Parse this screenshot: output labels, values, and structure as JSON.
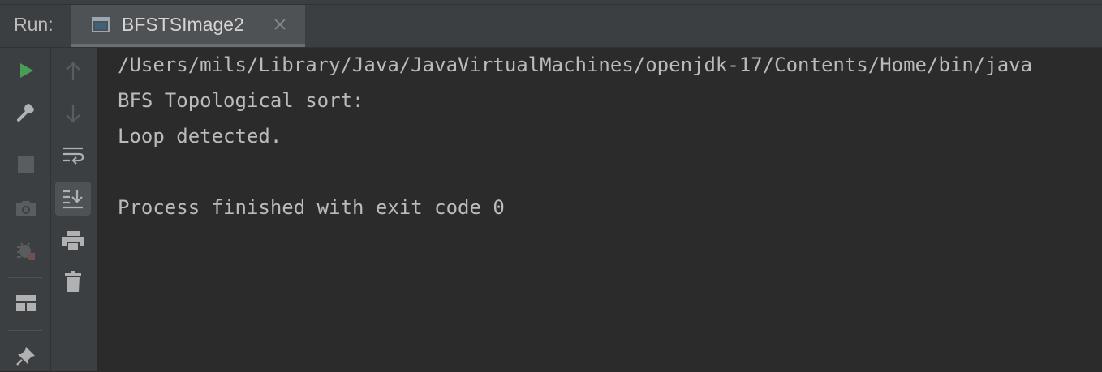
{
  "tool_window": {
    "label": "Run:",
    "tab": {
      "title": "BFSTSImage2",
      "icon": "console-window-icon",
      "close_icon": "close-icon"
    }
  },
  "left_toolbar": {
    "buttons": [
      {
        "name": "rerun-button",
        "icon": "play-icon",
        "color": "#499c54"
      },
      {
        "name": "edit-configuration-button",
        "icon": "wrench-icon"
      },
      {
        "name": "stop-button",
        "icon": "stop-icon",
        "disabled": true
      },
      {
        "name": "dump-threads-button",
        "icon": "camera-icon",
        "disabled": true
      },
      {
        "name": "debug-button",
        "icon": "bug-icon",
        "disabled": true
      },
      {
        "name": "restore-layout-button",
        "icon": "layout-icon"
      },
      {
        "name": "pin-tab-button",
        "icon": "pin-icon"
      }
    ]
  },
  "console_toolbar": {
    "buttons": [
      {
        "name": "up-stack-trace-button",
        "icon": "arrow-up-icon",
        "disabled": true
      },
      {
        "name": "down-stack-trace-button",
        "icon": "arrow-down-icon",
        "disabled": true
      },
      {
        "name": "soft-wrap-button",
        "icon": "soft-wrap-icon"
      },
      {
        "name": "scroll-to-end-button",
        "icon": "scroll-to-end-icon",
        "selected": true
      },
      {
        "name": "print-button",
        "icon": "printer-icon"
      },
      {
        "name": "clear-all-button",
        "icon": "trash-icon"
      }
    ]
  },
  "console": {
    "lines": [
      "/Users/mils/Library/Java/JavaVirtualMachines/openjdk-17/Contents/Home/bin/java",
      "BFS Topological sort:",
      "Loop detected.",
      "",
      "Process finished with exit code 0"
    ]
  }
}
